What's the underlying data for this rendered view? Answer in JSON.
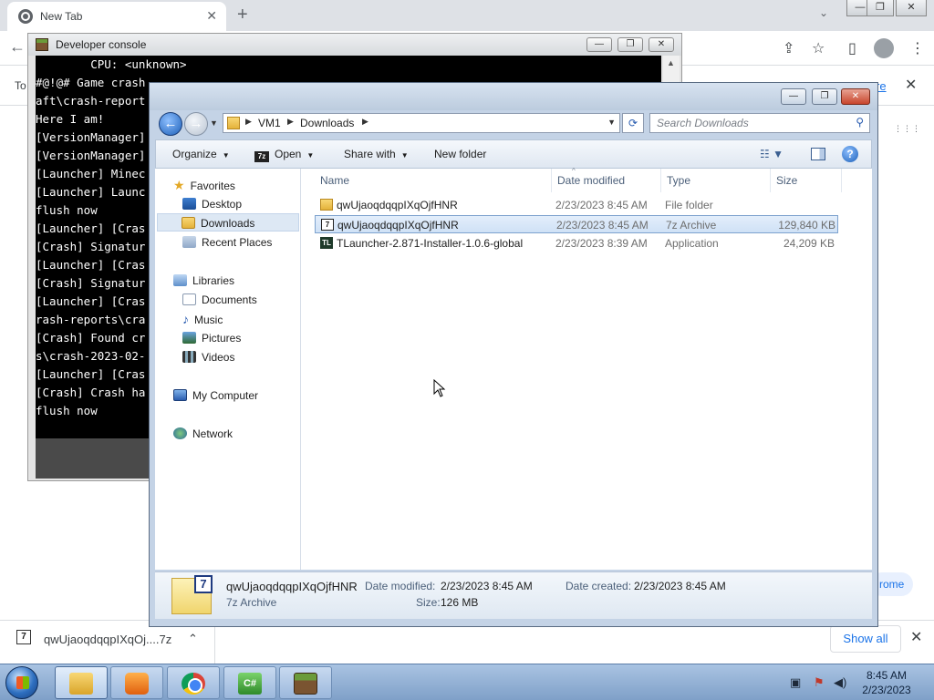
{
  "chrome": {
    "tab_title": "New Tab",
    "tab_close": "✕",
    "new_tab": "+",
    "tab_search": "⌄",
    "win_min": "—",
    "win_max": "❐",
    "win_close": "✕",
    "back": "←",
    "share_icon": "⇪",
    "star_icon": "☆",
    "sidepanel_icon": "▯",
    "menu_icon": "⋮",
    "infobar_text": "To",
    "infobar_link": "re",
    "infobar_close": "✕",
    "apps_icon": "⋮⋮⋮",
    "customize_label": "rome"
  },
  "downloads": {
    "icon_text": "7",
    "file_name": "qwUjaoqdqqpIXqOj....7z",
    "chevron": "⌃",
    "show_all": "Show all",
    "close": "✕"
  },
  "devcon": {
    "title": "Developer console",
    "btn_min": "—",
    "btn_max": "❐",
    "btn_close": "✕",
    "lines": [
      "        CPU: <unknown>",
      "#@!@# Game crash",
      "aft\\crash-report",
      "Here I am!",
      "[VersionManager]",
      "[VersionManager]",
      "[Launcher] Minec",
      "[Launcher] Launc",
      "flush now",
      "[Launcher] [Cras",
      "[Crash] Signatur",
      "[Launcher] [Cras",
      "[Crash] Signatur",
      "[Launcher] [Cras",
      "rash-reports\\cra",
      "[Crash] Found cr",
      "s\\crash-2023-02-",
      "[Launcher] [Cras",
      "[Crash] Crash ha",
      "flush now"
    ],
    "scroll_up": "▲",
    "scroll_down": "▼"
  },
  "explorer": {
    "cap_min": "—",
    "cap_max": "❐",
    "cap_close": "✕",
    "back": "←",
    "forward": "→",
    "recent": "▼",
    "breadcrumb": [
      "VM1",
      "Downloads"
    ],
    "crumb_sep": "▶",
    "addr_drop": "▼",
    "refresh": "⟳",
    "search_placeholder": "Search Downloads",
    "search_icon": "⚲",
    "toolbar": {
      "organize": "Organize",
      "open_icon": "7z",
      "open": "Open",
      "share_with": "Share with",
      "new_folder": "New folder",
      "dropdown": "▼",
      "views": "☷ ▼",
      "help": "?"
    },
    "nav": {
      "favorites": "Favorites",
      "desktop": "Desktop",
      "downloads": "Downloads",
      "recent_places": "Recent Places",
      "libraries": "Libraries",
      "documents": "Documents",
      "music": "Music",
      "pictures": "Pictures",
      "videos": "Videos",
      "my_computer": "My Computer",
      "network": "Network",
      "star_icon": "★",
      "music_icon": "♪"
    },
    "columns": {
      "name": "Name",
      "date_modified": "Date modified",
      "type": "Type",
      "size": "Size",
      "sort": "^"
    },
    "files": [
      {
        "name": "qwUjaoqdqqpIXqOjfHNR",
        "date": "2/23/2023 8:45 AM",
        "type": "File folder",
        "size": "",
        "kind": "folder",
        "icon": ""
      },
      {
        "name": "qwUjaoqdqqpIXqOjfHNR",
        "date": "2/23/2023 8:45 AM",
        "type": "7z Archive",
        "size": "129,840 KB",
        "kind": "archive",
        "icon": "7"
      },
      {
        "name": "TLauncher-2.871-Installer-1.0.6-global",
        "date": "2/23/2023 8:39 AM",
        "type": "Application",
        "size": "24,209 KB",
        "kind": "app",
        "icon": "TL"
      }
    ],
    "details": {
      "badge": "7",
      "name": "qwUjaoqdqqpIXqOjfHNR",
      "kind": "7z Archive",
      "date_modified_label": "Date modified:",
      "date_modified": "2/23/2023 8:45 AM",
      "size_label": "Size:",
      "size": "126 MB",
      "date_created_label": "Date created:",
      "date_created": "2/23/2023 8:45 AM"
    }
  },
  "taskbar": {
    "csharp": "C#",
    "tray_flag": "⚑",
    "tray_net": "▣",
    "tray_volume": "◀)",
    "time": "8:45 AM",
    "date": "2/23/2023"
  }
}
